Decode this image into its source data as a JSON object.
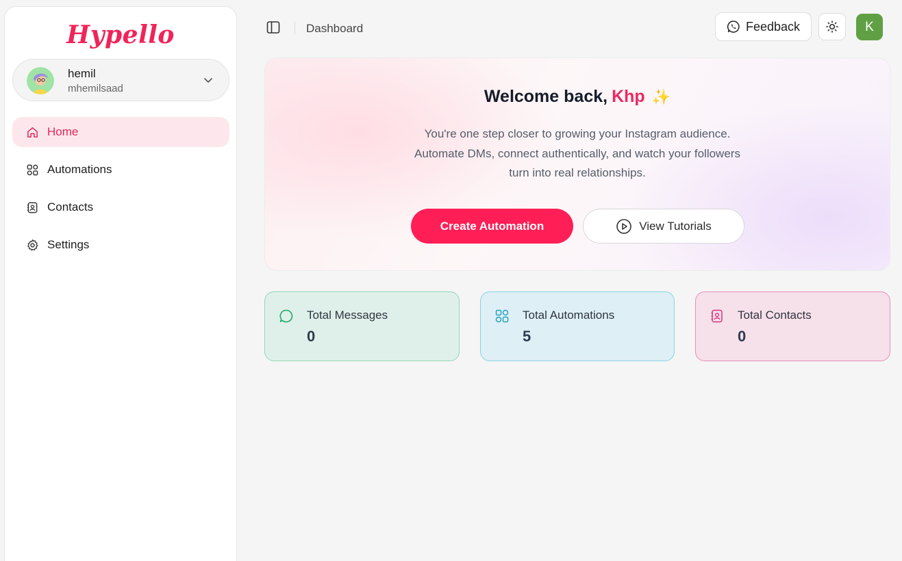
{
  "brand": {
    "logo_text": "Hypello",
    "color": "#f0245a"
  },
  "account": {
    "name": "hemil",
    "handle": "mhemilsaad"
  },
  "nav": [
    {
      "label": "Home",
      "icon": "home-icon",
      "active": true
    },
    {
      "label": "Automations",
      "icon": "grid-icon",
      "active": false
    },
    {
      "label": "Contacts",
      "icon": "contact-book-icon",
      "active": false
    },
    {
      "label": "Settings",
      "icon": "gear-icon",
      "active": false
    }
  ],
  "header": {
    "breadcrumb": "Dashboard",
    "feedback_label": "Feedback",
    "user_initial": "K"
  },
  "hero": {
    "greeting": "Welcome back,",
    "user_name": "Khp",
    "sparkle": "✨",
    "subtitle_lines": [
      "You're one step closer to growing your Instagram audience.",
      "Automate DMs, connect authentically, and watch your followers",
      "turn into real relationships."
    ],
    "primary_cta": "Create Automation",
    "secondary_cta": "View Tutorials"
  },
  "stats": [
    {
      "label": "Total Messages",
      "value": "0",
      "icon": "chat-bubble-icon",
      "color": "#1fa86a"
    },
    {
      "label": "Total Automations",
      "value": "5",
      "icon": "grid-icon",
      "color": "#1fa3c2"
    },
    {
      "label": "Total Contacts",
      "value": "0",
      "icon": "contact-book-icon",
      "color": "#d6337c"
    }
  ],
  "colors": {
    "accent": "#ff1f56",
    "active_nav_bg": "#fde7ec",
    "avatar_green": "#5fa044"
  }
}
